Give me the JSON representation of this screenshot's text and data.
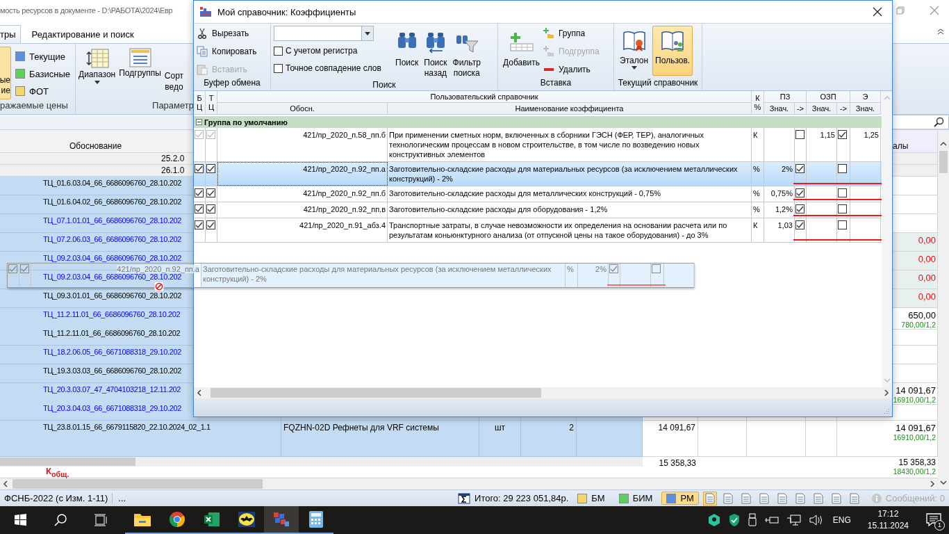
{
  "app": {
    "title": "мость ресурсов в документе - D:\\РАБОТА\\2024\\Евр",
    "tabs": [
      {
        "label": "тры",
        "selected": true
      },
      {
        "label": "Редактирование и поиск",
        "selected": false
      }
    ],
    "ribbon": {
      "price_button": {
        "lines": [
          "ые",
          "ие"
        ],
        "selected": true
      },
      "price_types": [
        {
          "label": "Текущие",
          "color": "#5b8fe0"
        },
        {
          "label": "Базисные",
          "color": "#5ccf5c"
        },
        {
          "label": "ФОТ",
          "color": "#f5d66b"
        }
      ],
      "price_group_label": "ражаемые цены",
      "buttons": [
        {
          "kind": "range",
          "lines": [
            "Диапазон"
          ],
          "dropdown": true
        },
        {
          "kind": "subgroups",
          "lines": [
            "Подгруппы"
          ],
          "dropdown": false
        },
        {
          "kind": "cut",
          "lines": [
            "Сорт",
            "ведо"
          ],
          "dropdown": false
        }
      ],
      "params_group_label": "Параметр"
    },
    "grid": {
      "header": "Обоснование",
      "right_header": "алы",
      "pre_rows": [
        "25.2.0",
        "26.1.0"
      ],
      "rows": [
        {
          "code": "ТЦ_01.6.03.04_66_6686096760_28.10.202",
          "color": "#000000",
          "selected": true
        },
        {
          "code": "ТЦ_01.6.04.02_66_6686096760_28.10.202",
          "color": "#000000",
          "selected": true
        },
        {
          "code": "ТЦ_07.1.01.01_66_6686096760_28.10.202",
          "color": "#0000ff",
          "selected": true
        },
        {
          "code": "ТЦ_07.2.06.03_66_6686096760_28.10.202",
          "color": "#0000ff",
          "selected": true,
          "right": {
            "text": "0,00",
            "color": "#ff0000"
          }
        },
        {
          "code": "ТЦ_09.2.03.04_66_6686096760_28.10.202",
          "color": "#0000ff",
          "selected": true,
          "right": {
            "text": "0,00",
            "color": "#ff0000"
          }
        },
        {
          "code": "ТЦ_09.2.03.04_66_6686096760_28.10.202",
          "color": "#0000ff",
          "selected": true,
          "right": {
            "text": "0,00",
            "color": "#ff0000"
          }
        },
        {
          "code": "ТЦ_09.3.01.01_66_6686096760_28.10.202",
          "color": "#000000",
          "selected": true,
          "right": {
            "text": "0,00",
            "color": "#ff0000"
          }
        },
        {
          "code": "ТЦ_11.2.11.01_66_6686096760_28.10.202",
          "color": "#0000ff",
          "selected": true,
          "right": {
            "text": "650,00",
            "color": "#000000"
          },
          "note": "780,00/1,2"
        },
        {
          "code": "ТЦ_11.2.11.01_66_6686096760_28.10.202",
          "color": "#000000",
          "selected": true
        },
        {
          "code": "ТЦ_18.2.06.05_66_6671088318_29.10.202",
          "color": "#0000ff",
          "selected": true
        },
        {
          "code": "ТЦ_19.3.03.03_66_6686096760_28.10.202",
          "color": "#000000",
          "selected": true
        },
        {
          "code": "ТЦ_20.3.03.07_47_4704103218_12.11.202",
          "color": "#0000ff",
          "selected": true,
          "right": {
            "text": "14 091,67",
            "color": "#000000"
          },
          "note": "16910,00/1,2"
        },
        {
          "code": "ТЦ_20.3.04.03_66_6671088318_29.10.202",
          "color": "#0000ff",
          "selected": true
        },
        {
          "code": "ТЦ_23.8.01.15_66_6679115820_22.10.2024_02_1.1",
          "color": "#000000",
          "selected": true,
          "name": "FQZHN-02D Рефнеты для VRF системы",
          "unit": "шт",
          "qty": "2",
          "mid": "14 091,67",
          "right": {
            "text": "14 091,67",
            "color": "#000000"
          },
          "note": "16910,00/1,2"
        }
      ],
      "total": {
        "label": "К$_{общ.}$",
        "mid": "15 358,33",
        "right": "15 358,33",
        "note": "18430,00/1,2"
      }
    }
  },
  "status_bar": {
    "norm_base": "ФСНБ-2022 (с Изм. 1-11)",
    "more": "...",
    "total": "Итого: 29 223 051,84р.",
    "price_modes": [
      {
        "label": "БМ",
        "color": "#f5d66b",
        "selected": false
      },
      {
        "label": "БИМ",
        "color": "#5ccf5c",
        "selected": false
      },
      {
        "label": "РМ",
        "color": "#5b8fe0",
        "selected": true
      }
    ],
    "views": [
      {
        "selected": true
      },
      {
        "selected": false
      },
      {
        "selected": false
      },
      {
        "selected": false
      },
      {
        "selected": false
      },
      {
        "selected": false
      },
      {
        "selected": false
      },
      {
        "selected": false
      },
      {
        "selected": false
      }
    ],
    "messages": {
      "label": "Сообщений: 0",
      "disabled": true
    }
  },
  "taskbar": {
    "apps": [
      {
        "kind": "folder",
        "active": false
      },
      {
        "kind": "browser",
        "active": false
      },
      {
        "kind": "spreadsheet",
        "active": false
      },
      {
        "kind": "bat",
        "active": false
      },
      {
        "kind": "blocks",
        "active": true
      },
      {
        "kind": "calculator",
        "active": false
      }
    ],
    "tray": {
      "language": "ENG",
      "time": "17:12",
      "date": "15.11.2024",
      "notifications": "1"
    }
  },
  "dialog": {
    "title": "Мой справочник: Коэффициенты",
    "clipboard": {
      "label": "Буфер обмена",
      "items": [
        {
          "kind": "cut",
          "label": "Вырезать",
          "disabled": false
        },
        {
          "kind": "copy",
          "label": "Копировать",
          "disabled": false
        },
        {
          "kind": "paste",
          "label": "Вставить",
          "disabled": true
        }
      ]
    },
    "search": {
      "label": "Поиск",
      "options": [
        {
          "label": "С учетом регистра",
          "checked": false
        },
        {
          "label": "Точное совпадение слов",
          "checked": false
        }
      ],
      "buttons": [
        {
          "kind": "find",
          "lines": [
            "Поиск"
          ]
        },
        {
          "kind": "find_back",
          "lines": [
            "Поиск",
            "назад"
          ]
        },
        {
          "kind": "filter",
          "lines": [
            "Фильтр",
            "поиска"
          ]
        }
      ]
    },
    "insert": {
      "label": "Вставка",
      "add": "Добавить",
      "items": [
        {
          "kind": "group",
          "label": "Группа",
          "disabled": false
        },
        {
          "kind": "subgroup",
          "label": "Подгруппа",
          "disabled": true
        },
        {
          "kind": "delete",
          "label": "Удалить",
          "disabled": false
        }
      ]
    },
    "reference": {
      "label": "Текущий справочник",
      "buttons": [
        {
          "kind": "standard",
          "label": "Эталон",
          "dropdown": true,
          "selected": false
        },
        {
          "kind": "user",
          "label": "Пользов.",
          "dropdown": false,
          "selected": true
        }
      ]
    },
    "table": {
      "header": {
        "bc": "Б Ц",
        "tc": "Т Ц",
        "group": "Пользовательский справочник",
        "code": "Обосн.",
        "name": "Наименование коэффициента",
        "k": "К %",
        "pz": "ПЗ",
        "pz_value": "Знач.",
        "pz_apply": "->",
        "ozp": "ОЗП",
        "ozp_value": "Знач.",
        "ozp_apply": "->",
        "e": "Э",
        "e_value": "Знач."
      },
      "group_row": {
        "label": "Группа по умолчанию",
        "expanded": true
      },
      "rows": [
        {
          "bc": true,
          "tc": true,
          "disabled": true,
          "selected": false,
          "code": "421/пр_2020_п.58_пп.б",
          "name": "При применении сметных норм, включенных в сборники ГЭСН (ФЕР, ТЕР), аналогичных технологическим процессам в новом строительстве, в том числе по возведению новых конструктивных элементов",
          "k": "К",
          "pz_apply": false,
          "ozp": "1,15",
          "ozp_apply": true,
          "e": "1,25"
        },
        {
          "bc": true,
          "tc": true,
          "disabled": false,
          "selected": true,
          "code": "421/пр_2020_п.92_пп.а",
          "name": "Заготовительно-складские расходы для материальных ресурсов (за исключением металлических конструкций) - 2%",
          "k": "%",
          "pz": "2%",
          "pz_apply": true,
          "ozp_apply": false
        },
        {
          "bc": true,
          "tc": true,
          "disabled": false,
          "selected": false,
          "code": "421/пр_2020_п.92_пп.б",
          "name": "Заготовительно-складские расходы для металлических конструкций - 0,75%",
          "k": "%",
          "pz": "0,75%",
          "pz_apply": true,
          "ozp_apply": false
        },
        {
          "bc": true,
          "tc": true,
          "disabled": false,
          "selected": false,
          "code": "421/пр_2020_п.92_пп.в",
          "name": "Заготовительно-складские расходы для оборудования - 1,2%",
          "k": "%",
          "pz": "1,2%",
          "pz_apply": true,
          "ozp_apply": false
        },
        {
          "bc": true,
          "tc": true,
          "disabled": false,
          "selected": false,
          "code": "421/пр_2020_п.91_абз.4",
          "name": "Транспортные затраты, в случае невозможности их определения на основании расчета или по результатам коньюнктурного анализа (от отпускной цены на такое оборудования) - до 3%",
          "k": "К",
          "pz": "1,03",
          "pz_apply": true,
          "ozp_apply": false
        }
      ]
    }
  },
  "drag_preview": {
    "bc": true,
    "tc": true,
    "code": "421/пр_2020_п.92_пп.а",
    "name": "Заготовительно-складские расходы для материальных ресурсов (за исключением металлических конструкций) - 2%",
    "k": "%",
    "pz": "2%",
    "pz_apply": true,
    "ozp_apply": false
  }
}
